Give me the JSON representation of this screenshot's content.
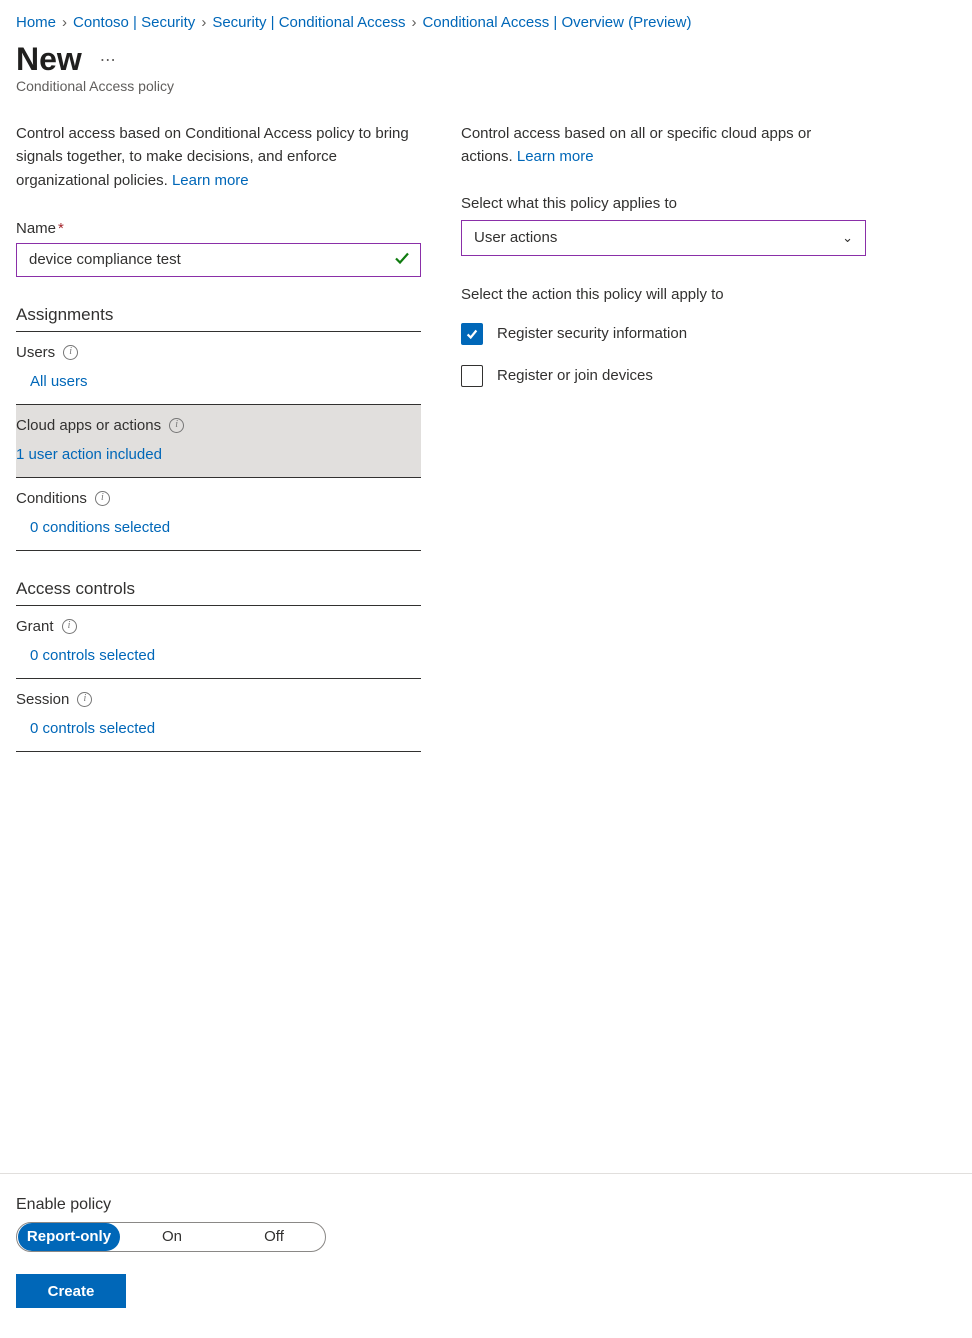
{
  "breadcrumb": {
    "items": [
      {
        "label": "Home"
      },
      {
        "label": "Contoso | Security"
      },
      {
        "label": "Security | Conditional Access"
      },
      {
        "label": "Conditional Access | Overview (Preview)"
      }
    ]
  },
  "header": {
    "title": "New",
    "subtitle": "Conditional Access policy"
  },
  "left": {
    "desc_text": "Control access based on Conditional Access policy to bring signals together, to make decisions, and enforce organizational policies. ",
    "learn_more": "Learn more",
    "name_label": "Name",
    "name_value": "device compliance test",
    "assignments_header": "Assignments",
    "users": {
      "label": "Users",
      "value": "All users"
    },
    "cloud": {
      "label": "Cloud apps or actions",
      "value": "1 user action included"
    },
    "conditions": {
      "label": "Conditions",
      "value": "0 conditions selected"
    },
    "access_header": "Access controls",
    "grant": {
      "label": "Grant",
      "value": "0 controls selected"
    },
    "session": {
      "label": "Session",
      "value": "0 controls selected"
    }
  },
  "right": {
    "desc_text": "Control access based on all or specific cloud apps or actions. ",
    "learn_more": "Learn more",
    "applies_label": "Select what this policy applies to",
    "applies_value": "User actions",
    "action_label": "Select the action this policy will apply to",
    "actions": [
      {
        "label": "Register security information",
        "checked": true
      },
      {
        "label": "Register or join devices",
        "checked": false
      }
    ]
  },
  "footer": {
    "enable_label": "Enable policy",
    "options": [
      "Report-only",
      "On",
      "Off"
    ],
    "selected": "Report-only",
    "create_label": "Create"
  }
}
